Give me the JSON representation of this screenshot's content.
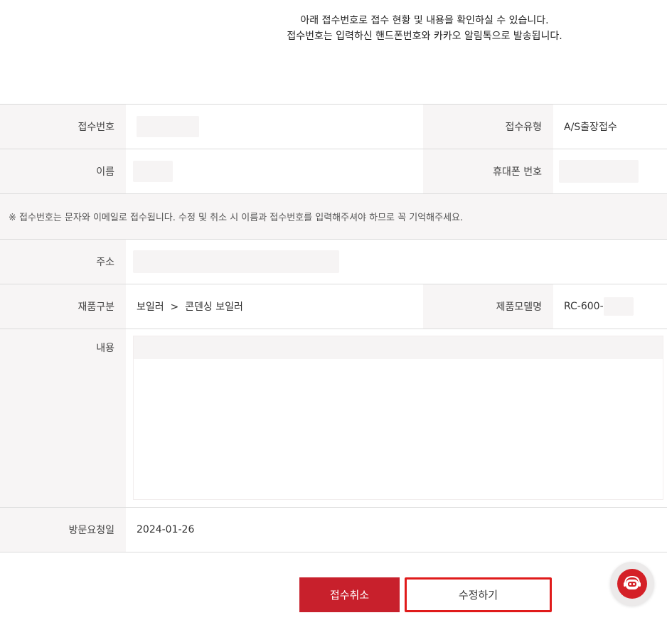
{
  "notice": {
    "line1": "아래 접수번호로 접수 현황 및 내용을 확인하실 수 있습니다.",
    "line2": "접수번호는 입력하신 핸드폰번호와 카카오 알림톡으로 발송됩니다."
  },
  "form": {
    "receipt_no_label": "접수번호",
    "receipt_no_value": "",
    "receipt_type_label": "접수유형",
    "receipt_type_value": "A/S출장접수",
    "name_label": "이름",
    "name_value": "",
    "phone_label": "휴대폰 번호",
    "phone_value": "",
    "note": "※ 접수번호는 문자와 이메일로 접수됩니다. 수정 및 취소 시 이름과 접수번호를 입력해주셔야 하므로 꼭 기억해주세요.",
    "address_label": "주소",
    "address_value": "",
    "category_label": "재품구분",
    "category_value": "보일러  >  콘덴싱 보일러",
    "model_label": "제품모델명",
    "model_value": "RC-600-",
    "content_label": "내용",
    "content_value": "",
    "visit_label": "방문요청일",
    "visit_value": "2024-01-26"
  },
  "buttons": {
    "cancel": "접수취소",
    "edit": "수정하기"
  },
  "icons": {
    "chat": "chatbot-icon"
  },
  "colors": {
    "accent": "#c8202c",
    "highlight_border": "#e01b1b"
  }
}
